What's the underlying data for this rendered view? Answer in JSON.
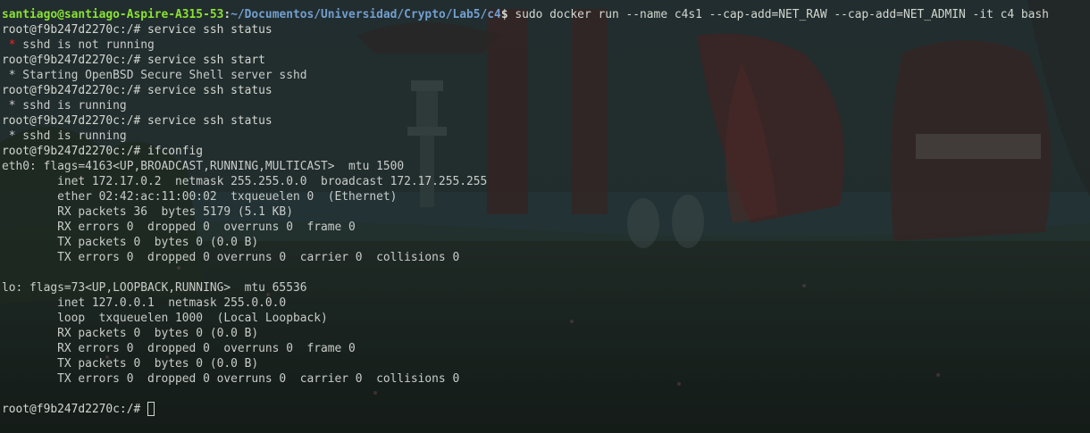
{
  "prompt_host": {
    "user_host": "santiago@santiago-Aspire-A315-53",
    "separator": ":",
    "path": "~/Documentos/Universidad/Crypto/Lab5/c4",
    "symbol": "$",
    "command": " sudo docker run --name c4s1 --cap-add=NET_RAW --cap-add=NET_ADMIN -it c4 bash"
  },
  "container_prompt": "root@f9b247d2270c:/# ",
  "lines": [
    {
      "kind": "cmd",
      "text": "service ssh status"
    },
    {
      "kind": "err",
      "star": " *",
      "text": " sshd is not running"
    },
    {
      "kind": "cmd",
      "text": "service ssh start"
    },
    {
      "kind": "out",
      "text": " * Starting OpenBSD Secure Shell server sshd"
    },
    {
      "kind": "cmd",
      "text": "service ssh status"
    },
    {
      "kind": "out",
      "text": " * sshd is running"
    },
    {
      "kind": "cmd",
      "text": "service ssh status"
    },
    {
      "kind": "out",
      "text": " * sshd is running"
    },
    {
      "kind": "cmd",
      "text": "ifconfig"
    },
    {
      "kind": "out",
      "text": "eth0: flags=4163<UP,BROADCAST,RUNNING,MULTICAST>  mtu 1500"
    },
    {
      "kind": "out",
      "text": "        inet 172.17.0.2  netmask 255.255.0.0  broadcast 172.17.255.255"
    },
    {
      "kind": "out",
      "text": "        ether 02:42:ac:11:00:02  txqueuelen 0  (Ethernet)"
    },
    {
      "kind": "out",
      "text": "        RX packets 36  bytes 5179 (5.1 KB)"
    },
    {
      "kind": "out",
      "text": "        RX errors 0  dropped 0  overruns 0  frame 0"
    },
    {
      "kind": "out",
      "text": "        TX packets 0  bytes 0 (0.0 B)"
    },
    {
      "kind": "out",
      "text": "        TX errors 0  dropped 0 overruns 0  carrier 0  collisions 0"
    },
    {
      "kind": "out",
      "text": ""
    },
    {
      "kind": "out",
      "text": "lo: flags=73<UP,LOOPBACK,RUNNING>  mtu 65536"
    },
    {
      "kind": "out",
      "text": "        inet 127.0.0.1  netmask 255.0.0.0"
    },
    {
      "kind": "out",
      "text": "        loop  txqueuelen 1000  (Local Loopback)"
    },
    {
      "kind": "out",
      "text": "        RX packets 0  bytes 0 (0.0 B)"
    },
    {
      "kind": "out",
      "text": "        RX errors 0  dropped 0  overruns 0  frame 0"
    },
    {
      "kind": "out",
      "text": "        TX packets 0  bytes 0 (0.0 B)"
    },
    {
      "kind": "out",
      "text": "        TX errors 0  dropped 0 overruns 0  carrier 0  collisions 0"
    },
    {
      "kind": "out",
      "text": ""
    },
    {
      "kind": "prompt",
      "text": ""
    }
  ],
  "colors": {
    "user_host": "#8ae234",
    "path": "#729fcf",
    "text": "#c9ccc9",
    "error_star": "#ef2929",
    "background": "#1f2c2c"
  }
}
